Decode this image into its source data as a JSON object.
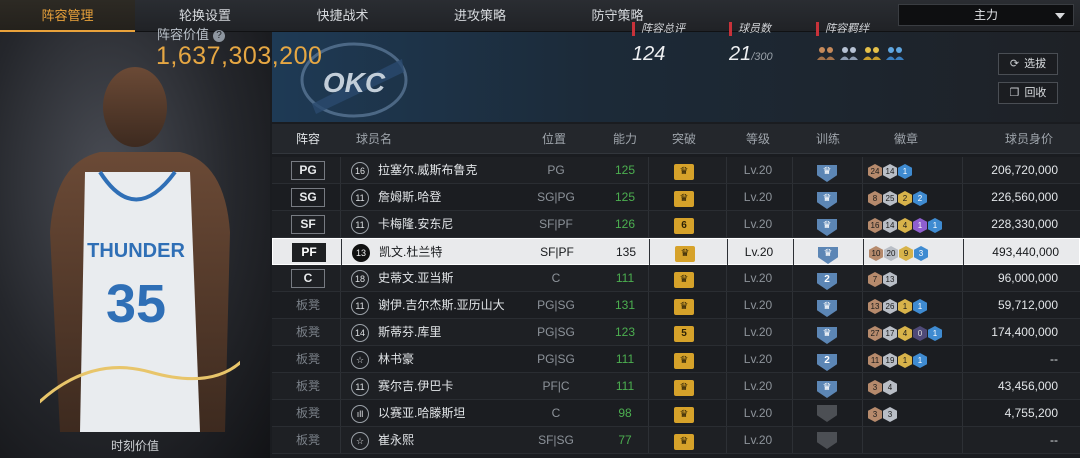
{
  "nav": {
    "tabs": [
      "阵容管理",
      "轮换设置",
      "快捷战术",
      "进攻策略",
      "防守策略"
    ],
    "active_tab": 0,
    "lineup_select": "主力"
  },
  "poster": {
    "moment_label": "时刻价值",
    "jersey_team": "THUNDER",
    "jersey_number": "35"
  },
  "summary": {
    "value_label": "阵容价值",
    "value": "1,637,303,200",
    "rating_label": "阵容总评",
    "rating": "124",
    "count_label": "球员数",
    "count": "21",
    "count_max": "/300",
    "bond_label": "阵容羁绊",
    "draft_button": "选拔",
    "recycle_button": "回收",
    "team_logo_text": "OKC"
  },
  "table": {
    "headers": [
      "阵容",
      "球员名",
      "位置",
      "能力",
      "突破",
      "等级",
      "训练",
      "徽章",
      "球员身价"
    ],
    "rows": [
      {
        "slot": "PG",
        "num": "16",
        "name": "拉塞尔.威斯布鲁克",
        "role": "PG",
        "ability": "125",
        "brk": "",
        "level": "Lv.20",
        "train": "",
        "badges": [
          [
            "bronze",
            "24"
          ],
          [
            "silver",
            "14"
          ],
          [
            "blue",
            "1"
          ]
        ],
        "salary": "206,720,000",
        "selected": false,
        "bench": false
      },
      {
        "slot": "SG",
        "num": "11",
        "name": "詹姆斯.哈登",
        "role": "SG|PG",
        "ability": "125",
        "brk": "",
        "level": "Lv.20",
        "train": "",
        "badges": [
          [
            "bronze",
            "8"
          ],
          [
            "silver",
            "25"
          ],
          [
            "gold",
            "2"
          ],
          [
            "blue",
            "2"
          ]
        ],
        "salary": "226,560,000",
        "selected": false,
        "bench": false
      },
      {
        "slot": "SF",
        "num": "11",
        "name": "卡梅隆.安东尼",
        "role": "SF|PF",
        "ability": "126",
        "brk": "6",
        "level": "Lv.20",
        "train": "",
        "badges": [
          [
            "bronze",
            "16"
          ],
          [
            "silver",
            "14"
          ],
          [
            "gold",
            "4"
          ],
          [
            "purple",
            "1"
          ],
          [
            "blue",
            "1"
          ]
        ],
        "salary": "228,330,000",
        "selected": false,
        "bench": false
      },
      {
        "slot": "PF",
        "num": "13",
        "name": "凯文.杜兰特",
        "role": "SF|PF",
        "ability": "135",
        "brk": "",
        "level": "Lv.20",
        "train": "",
        "badges": [
          [
            "bronze",
            "10"
          ],
          [
            "silver",
            "20"
          ],
          [
            "gold",
            "9"
          ],
          [
            "blue",
            "3"
          ]
        ],
        "salary": "493,440,000",
        "selected": true,
        "bench": false
      },
      {
        "slot": "C",
        "num": "18",
        "name": "史蒂文.亚当斯",
        "role": "C",
        "ability": "111",
        "brk": "",
        "level": "Lv.20",
        "train": "2",
        "badges": [
          [
            "bronze",
            "7"
          ],
          [
            "silver",
            "13"
          ]
        ],
        "salary": "96,000,000",
        "selected": false,
        "bench": false
      },
      {
        "slot": "板凳",
        "num": "11",
        "name": "谢伊.吉尔杰斯.亚历山大",
        "role": "PG|SG",
        "ability": "131",
        "brk": "",
        "level": "Lv.20",
        "train": "",
        "badges": [
          [
            "bronze",
            "13"
          ],
          [
            "silver",
            "26"
          ],
          [
            "gold",
            "1"
          ],
          [
            "blue",
            "1"
          ]
        ],
        "salary": "59,712,000",
        "selected": false,
        "bench": true
      },
      {
        "slot": "板凳",
        "num": "14",
        "name": "斯蒂芬.库里",
        "role": "PG|SG",
        "ability": "123",
        "brk": "5",
        "level": "Lv.20",
        "train": "",
        "badges": [
          [
            "bronze",
            "27"
          ],
          [
            "silver",
            "17"
          ],
          [
            "gold",
            "4"
          ],
          [
            "dark",
            "0"
          ],
          [
            "blue",
            "1"
          ]
        ],
        "salary": "174,400,000",
        "selected": false,
        "bench": true
      },
      {
        "slot": "板凳",
        "num": "☆",
        "name": "林书豪",
        "role": "PG|SG",
        "ability": "111",
        "brk": "",
        "level": "Lv.20",
        "train": "2",
        "badges": [
          [
            "bronze",
            "11"
          ],
          [
            "silver",
            "19"
          ],
          [
            "gold",
            "1"
          ],
          [
            "blue",
            "1"
          ]
        ],
        "salary": "--",
        "selected": false,
        "bench": true
      },
      {
        "slot": "板凳",
        "num": "11",
        "name": "赛尔吉.伊巴卡",
        "role": "PF|C",
        "ability": "111",
        "brk": "",
        "level": "Lv.20",
        "train": "",
        "badges": [
          [
            "bronze",
            "3"
          ],
          [
            "silver",
            "4"
          ]
        ],
        "salary": "43,456,000",
        "selected": false,
        "bench": true
      },
      {
        "slot": "板凳",
        "num": "ıll",
        "name": "以赛亚.哈滕斯坦",
        "role": "C",
        "ability": "98",
        "brk": "",
        "level": "Lv.20",
        "train": "gray",
        "badges": [
          [
            "bronze",
            "3"
          ],
          [
            "silver",
            "3"
          ]
        ],
        "salary": "4,755,200",
        "selected": false,
        "bench": true
      },
      {
        "slot": "板凳",
        "num": "☆",
        "name": "崔永熙",
        "role": "SF|SG",
        "ability": "77",
        "brk": "",
        "level": "Lv.20",
        "train": "gray",
        "badges": [],
        "salary": "--",
        "selected": false,
        "bench": true
      }
    ]
  }
}
